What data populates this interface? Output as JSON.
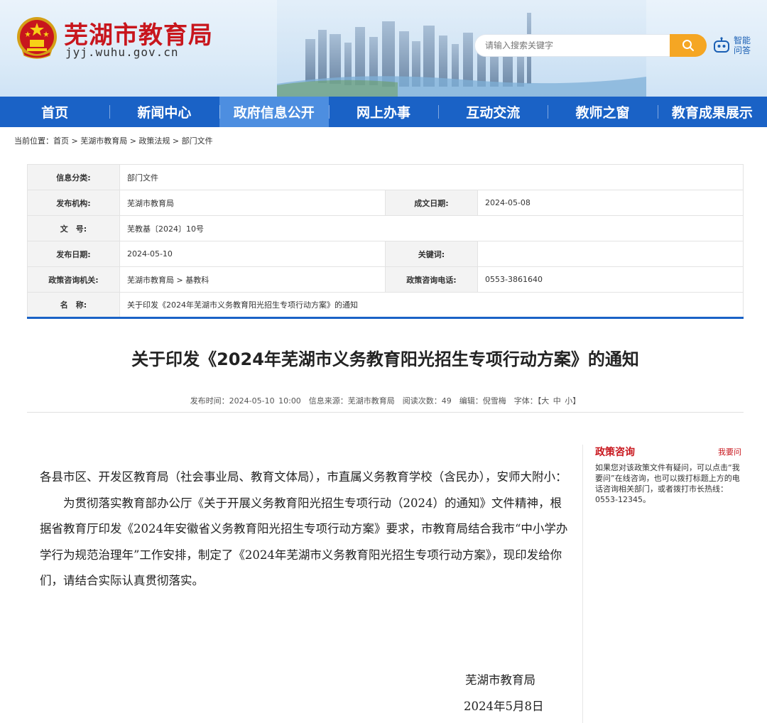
{
  "header": {
    "site_title": "芜湖市教育局",
    "site_domain": "jyj.wuhu.gov.cn",
    "search_placeholder": "请输入搜索关键字",
    "assistant_label": "智能问答",
    "accent": "#1a62c6",
    "brand_red": "#c8161d",
    "search_button_color": "#f5a623"
  },
  "nav": {
    "items": [
      "首页",
      "新闻中心",
      "政府信息公开",
      "网上办事",
      "互动交流",
      "教师之窗",
      "教育成果展示"
    ],
    "active": "政府信息公开"
  },
  "breadcrumb": "当前位置：首页 > 芜湖市教育局 > 政策法规 > 部门文件",
  "info": {
    "category_label": "信息分类:",
    "category": "部门文件",
    "issuer_label": "发布机构:",
    "issuer": "芜湖市教育局",
    "created_label": "成文日期:",
    "created": "2024-05-08",
    "doc_no_label": "文　号:",
    "doc_no": "芜教基〔2024〕10号",
    "publish_label": "发布日期:",
    "publish": "2024-05-10",
    "keywords_label": "关键词:",
    "keywords": "",
    "consult_org_label": "政策咨询机关:",
    "consult_org": "芜湖市教育局 > 基教科",
    "consult_phone_label": "政策咨询电话:",
    "consult_phone": "0553-3861640",
    "name_label": "名　称:",
    "name": "关于印发《2024年芜湖市义务教育阳光招生专项行动方案》的通知"
  },
  "article": {
    "title": "关于印发《2024年芜湖市义务教育阳光招生专项行动方案》的通知",
    "meta": "发布时间：2024-05-10 10:00　信息来源：芜湖市教育局　阅读次数：49　编辑：倪雪梅　字体：【大 中 小】",
    "salutation": "各县市区、开发区教育局（社会事业局、教育文体局），市直属义务教育学校（含民办），安师大附小：",
    "paragraph": "为贯彻落实教育部办公厅《关于开展义务教育阳光招生专项行动（2024）的通知》文件精神，根据省教育厅印发《2024年安徽省义务教育阳光招生专项行动方案》要求，市教育局结合我市“中小学办学行为规范治理年”工作安排，制定了《2024年芜湖市义务教育阳光招生专项行动方案》，现印发给你们，请结合实际认真贯彻落实。",
    "signature": "芜湖市教育局",
    "date": "2024年5月8日"
  },
  "side": {
    "title": "政策咨询",
    "link": "我要问",
    "text": "如果您对该政策文件有疑问，可以点击“我要问”在线咨询，也可以拨打标题上方的电话咨询相关部门，或者拨打市长热线：0553-12345。"
  }
}
